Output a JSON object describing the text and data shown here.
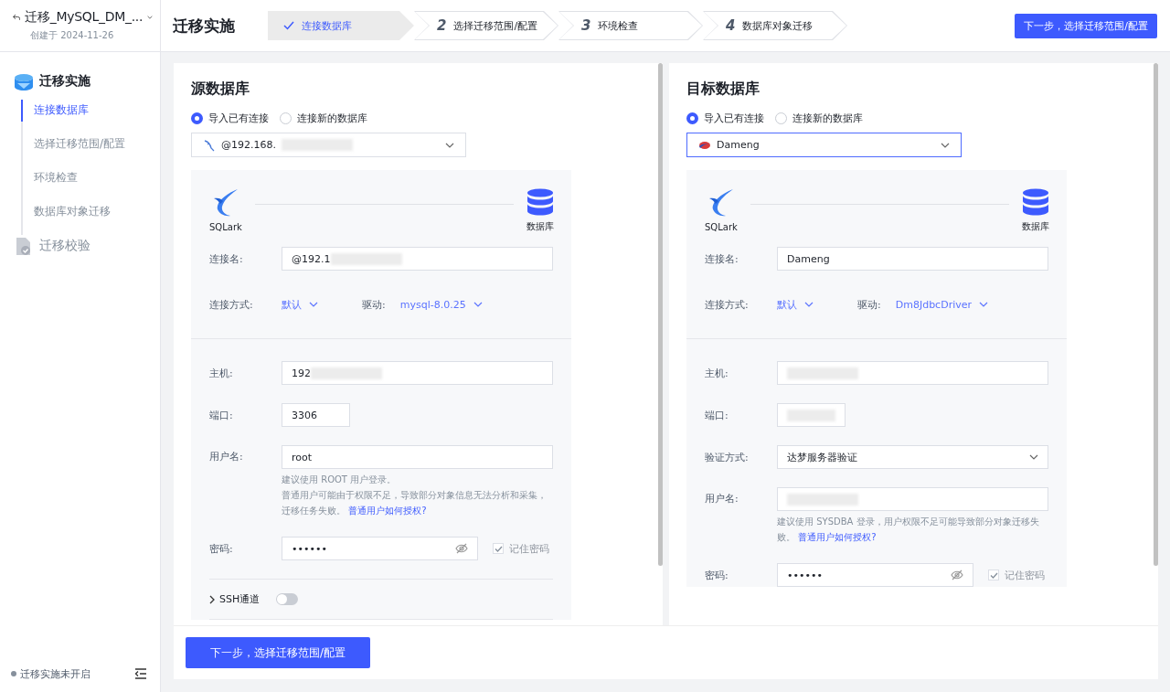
{
  "project": {
    "title": "迁移_MySQL_DM_...",
    "created": "创建于 2024-11-26"
  },
  "sidebar": {
    "groups": [
      {
        "label": "迁移实施",
        "kind": "db",
        "disabled": false,
        "children": [
          {
            "label": "连接数据库",
            "selected": true
          },
          {
            "label": "选择迁移范围/配置",
            "selected": false
          },
          {
            "label": "环境检查",
            "selected": false
          },
          {
            "label": "数据库对象迁移",
            "selected": false
          }
        ]
      },
      {
        "label": "迁移校验",
        "kind": "check",
        "disabled": true
      }
    ],
    "status": "迁移实施未开启"
  },
  "header": {
    "title": "迁移实施",
    "steps": [
      {
        "kind": "done",
        "label": "连接数据库",
        "selected": true
      },
      {
        "kind": "pending",
        "number": "2",
        "label": "选择迁移范围/配置",
        "selected": false
      },
      {
        "kind": "pending",
        "number": "3",
        "label": "环境检查",
        "selected": false
      },
      {
        "kind": "pending",
        "number": "4",
        "label": "数据库对象迁移",
        "selected": false
      }
    ],
    "next_button": "下一步，选择迁移范围/配置"
  },
  "panels": [
    {
      "title": "源数据库",
      "options": [
        {
          "label": "导入已有连接",
          "selected": true
        },
        {
          "label": "连接新的数据库",
          "selected": false
        }
      ],
      "connection": {
        "kind": "mysql",
        "value": "@192.168.",
        "redacted": true,
        "focused": false
      },
      "card": {
        "left_label": "SQLark",
        "right_label": "数据库"
      },
      "name": {
        "label": "连接名:",
        "value": "@192.1",
        "redacted": true
      },
      "method": {
        "label": "连接方式:",
        "value": "默认"
      },
      "driver": {
        "label": "驱动:",
        "value": "mysql-8.0.25"
      },
      "fields": [
        {
          "kind": "text",
          "label": "主机:",
          "value": "192",
          "redacted": true
        },
        {
          "kind": "short",
          "label": "端口:",
          "value": "3306",
          "redacted": false
        },
        {
          "kind": "text",
          "label": "用户名:",
          "value": "root",
          "redacted": false,
          "hint": [
            "建议使用 ROOT 用户登录。",
            "普通用户可能由于权限不足，导致部分对象信息无法分析和采集，",
            "迁移任务失败。"
          ],
          "hint_link": "普通用户如何授权?"
        },
        {
          "kind": "password",
          "label": "密码:",
          "value": "••••••",
          "redacted": false,
          "remember": {
            "label": "记住密码",
            "checked": true,
            "disabled": true
          }
        }
      ],
      "ssh": {
        "label": "SSH通道",
        "on": false
      }
    },
    {
      "title": "目标数据库",
      "options": [
        {
          "label": "导入已有连接",
          "selected": true
        },
        {
          "label": "连接新的数据库",
          "selected": false
        }
      ],
      "connection": {
        "kind": "dameng",
        "value": "Dameng",
        "redacted": false,
        "focused": true
      },
      "card": {
        "left_label": "SQLark",
        "right_label": "数据库"
      },
      "name": {
        "label": "连接名:",
        "value": "Dameng",
        "redacted": false
      },
      "method": {
        "label": "连接方式:",
        "value": "默认"
      },
      "driver": {
        "label": "驱动:",
        "value": "Dm8JdbcDriver"
      },
      "fields": [
        {
          "kind": "text",
          "label": "主机:",
          "redacted": true
        },
        {
          "kind": "short",
          "label": "端口:",
          "redacted": true
        },
        {
          "kind": "select",
          "label": "验证方式:",
          "value": "达梦服务器验证",
          "redacted": false
        },
        {
          "kind": "text",
          "label": "用户名:",
          "redacted": true,
          "hint": [
            "建议使用 SYSDBA 登录，用户权限不足可能导致部分对象迁移失败。"
          ],
          "hint_link": "普通用户如何授权?"
        },
        {
          "kind": "password",
          "label": "密码:",
          "value": "••••••",
          "redacted": false,
          "remember": {
            "label": "记住密码",
            "checked": true,
            "disabled": true
          }
        }
      ]
    }
  ],
  "footer_button": "下一步，选择迁移范围/配置"
}
